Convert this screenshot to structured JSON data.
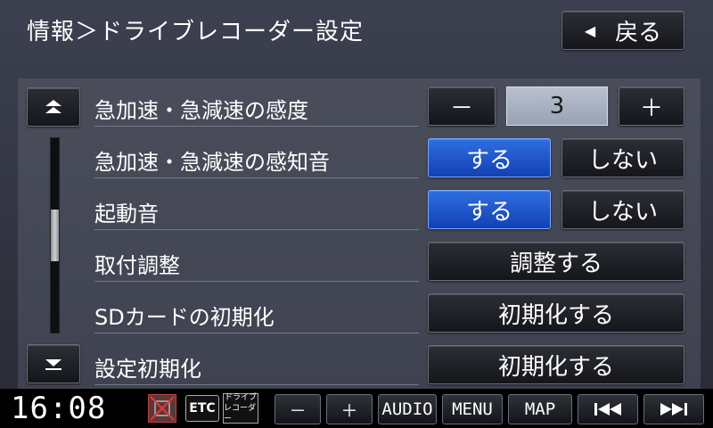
{
  "header": {
    "title": "情報＞ドライブレコーダー設定",
    "back_label": "戻る",
    "back_icon": "left-triangle-icon"
  },
  "settings": [
    {
      "label": "急加速・急減速の感度"
    },
    {
      "label": "急加速・急減速の感知音",
      "on_label": "する",
      "off_label": "しない",
      "selected": "on"
    },
    {
      "label": "起動音",
      "on_label": "する",
      "off_label": "しない",
      "selected": "on"
    },
    {
      "label": "取付調整",
      "action_label": "調整する"
    },
    {
      "label": "SDカードの初期化",
      "action_label": "初期化する"
    },
    {
      "label": "設定初期化",
      "action_label": "初期化する"
    }
  ],
  "sensitivity": {
    "minus_label": "－",
    "value": "3",
    "plus_label": "＋"
  },
  "scroll": {
    "up_icon": "double-chevron-up-icon",
    "down_icon": "chevron-down-icon",
    "position": 0.5
  },
  "statusbar": {
    "time": "16:08",
    "etc_label": "ETC",
    "recorder_label_line1": "ドライブ",
    "recorder_label_line2": "レコーダー",
    "vol_minus": "－",
    "vol_plus": "＋",
    "audio": "AUDIO",
    "menu": "MENU",
    "map": "MAP",
    "prev_icon": "skip-previous-icon",
    "next_icon": "skip-next-icon"
  },
  "colors": {
    "selected_blue": "#1f55cf",
    "panel": "#454856",
    "background": "#353846"
  }
}
